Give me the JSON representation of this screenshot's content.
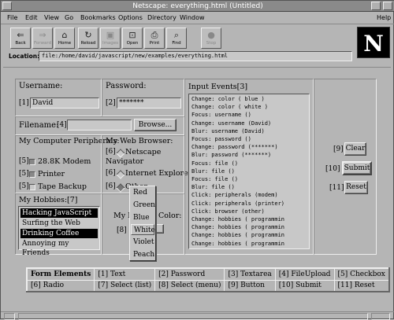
{
  "window": {
    "title": "Netscape: everything.html (Untitled)"
  },
  "menu": {
    "items": [
      "File",
      "Edit",
      "View",
      "Go",
      "Bookmarks",
      "Options",
      "Directory",
      "Window"
    ],
    "help": "Help"
  },
  "toolbar": {
    "buttons": [
      {
        "label": "Back",
        "icon": "back-arrow-icon",
        "glyph": "⇐"
      },
      {
        "label": "Forward",
        "icon": "forward-arrow-icon",
        "glyph": "⇒"
      },
      {
        "label": "Home",
        "icon": "home-icon",
        "glyph": "⌂"
      },
      {
        "label": "Reload",
        "icon": "reload-icon",
        "glyph": "↻"
      },
      {
        "label": "Images",
        "icon": "images-icon",
        "glyph": "▣"
      },
      {
        "label": "Open",
        "icon": "open-icon",
        "glyph": "⊡"
      },
      {
        "label": "Print",
        "icon": "print-icon",
        "glyph": "⎙"
      },
      {
        "label": "Find",
        "icon": "find-icon",
        "glyph": "⌕"
      },
      {
        "label": "Stop",
        "icon": "stop-icon",
        "glyph": "●"
      }
    ],
    "disabled": [
      "Forward",
      "Images",
      "Stop"
    ]
  },
  "logo": {
    "letter": "N"
  },
  "location": {
    "label": "Location:",
    "value": "file:/home/david/javascript/new/examples/everything.html"
  },
  "form": {
    "username": {
      "label": "Username:",
      "index": "[1]",
      "value": "David"
    },
    "password": {
      "label": "Password:",
      "index": "[2]",
      "value": "*******"
    },
    "filename": {
      "label": "Filename:",
      "index": "[4]",
      "value": "",
      "browse": "Browse..."
    },
    "peripherals": {
      "title": "My Computer Peripherals:",
      "items": [
        {
          "index": "[5]",
          "label": "28.8K Modem",
          "checked": true
        },
        {
          "index": "[5]",
          "label": "Printer",
          "checked": true
        },
        {
          "index": "[5]",
          "label": "Tape Backup",
          "checked": false
        }
      ]
    },
    "browser": {
      "title": "My Web Browser:",
      "items": [
        {
          "index": "[6]",
          "label": "Netscape",
          "label2": "Navigator",
          "checked": false
        },
        {
          "index": "[6]",
          "label": "Internet Explorer",
          "checked": false
        },
        {
          "index": "[6]",
          "label": "Other",
          "checked": true
        }
      ]
    },
    "hobbies": {
      "title": "My Hobbies:[7]",
      "items": [
        {
          "label": "Hacking JavaScript",
          "selected": true
        },
        {
          "label": "Surfing the Web",
          "selected": false
        },
        {
          "label": "Drinking Coffee",
          "selected": true
        },
        {
          "label": "Annoying my Friends",
          "selected": false
        }
      ]
    },
    "color": {
      "label_left": "My F",
      "label_right": "Color:",
      "index": "[8]",
      "options": [
        "Red",
        "Green",
        "Blue",
        "White",
        "Violet",
        "Peach"
      ],
      "selected": "White"
    },
    "events": {
      "title": "Input Events[3]",
      "lines": [
        "Change: color ( blue )",
        "Change: color ( white )",
        "Focus: username ()",
        "Change: username (David)",
        "Blur: username (David)",
        "Focus: password ()",
        "Change: password (*******)",
        "Blur: password (*******)",
        "Focus: file ()",
        "Blur: file ()",
        "Focus: file ()",
        "Blur: file ()",
        "Click: peripherals (modem)",
        "Click: peripherals (printer)",
        "Click: browser (other)",
        "Change: hobbies ( programmin",
        "Change: hobbies ( programmin",
        "Change: hobbies ( programmin",
        "Change: hobbies ( programmin"
      ]
    },
    "buttons": [
      {
        "index": "[9]",
        "label": "Clear"
      },
      {
        "index": "[10]",
        "label": "Submit"
      },
      {
        "index": "[11]",
        "label": "Reset"
      }
    ]
  },
  "legend": {
    "rows": [
      [
        "Form Elements",
        "[1] Text",
        "[2] Password",
        "[3] Textarea",
        "[4] FileUpload",
        "[5] Checkbox"
      ],
      [
        "[6] Radio",
        "[7] Select (list)",
        "[8] Select (menu)",
        "[9] Button",
        "[10] Submit",
        "[11] Reset"
      ]
    ]
  }
}
